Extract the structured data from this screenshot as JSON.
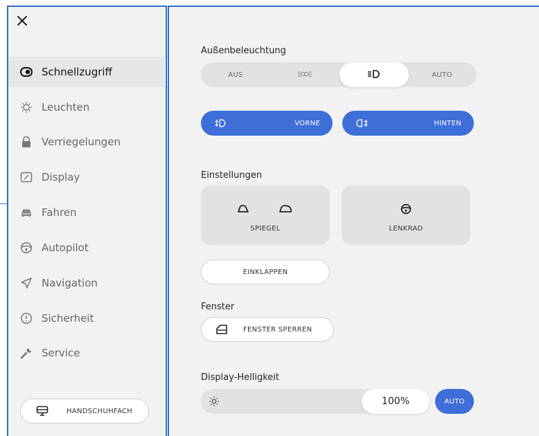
{
  "sidebar": {
    "close_icon": "close-icon",
    "items": [
      {
        "label": "Schnellzugriff",
        "icon": "toggle-icon",
        "active": true
      },
      {
        "label": "Leuchten",
        "icon": "bulb-icon"
      },
      {
        "label": "Verriegelungen",
        "icon": "lock-icon"
      },
      {
        "label": "Display",
        "icon": "display-icon"
      },
      {
        "label": "Fahren",
        "icon": "car-icon"
      },
      {
        "label": "Autopilot",
        "icon": "steering-wheel-icon"
      },
      {
        "label": "Navigation",
        "icon": "navigation-arrow-icon"
      },
      {
        "label": "Sicherheit",
        "icon": "alert-circle-icon"
      },
      {
        "label": "Service",
        "icon": "wrench-icon"
      }
    ],
    "glovebox_label": "HANDSCHUHFACH"
  },
  "lighting": {
    "title": "Außenbeleuchtung",
    "options": [
      {
        "label": "AUS",
        "type": "text"
      },
      {
        "label": "parking-lights-icon",
        "type": "icon"
      },
      {
        "label": "low-beam-icon",
        "type": "icon",
        "selected": true
      },
      {
        "label": "AUTO",
        "type": "text"
      }
    ],
    "fog_front_label": "VORNE",
    "fog_rear_label": "HINTEN"
  },
  "settings": {
    "title": "Einstellungen",
    "mirror_label": "SPIEGEL",
    "steering_label": "LENKRAD",
    "fold_label": "EINKLAPPEN"
  },
  "windows": {
    "title": "Fenster",
    "lock_label": "FENSTER SPERREN"
  },
  "brightness": {
    "title": "Display-Helligkeit",
    "value": "100%",
    "auto_label": "AUTO"
  },
  "colors": {
    "accent": "#3e6ed8",
    "frame_border": "#2f6fc7"
  }
}
